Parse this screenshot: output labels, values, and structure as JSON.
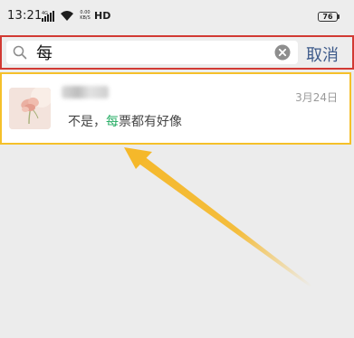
{
  "status_bar": {
    "time": "13:21",
    "network_type": "4G",
    "speed_value": "0.00",
    "speed_unit": "KB/S",
    "hd_label": "HD",
    "battery_level": "76"
  },
  "search": {
    "query": "每",
    "cancel_label": "取消"
  },
  "result": {
    "date": "3月24日",
    "message_prefix": "不是，",
    "message_highlight": "每",
    "message_suffix": "票都有好像"
  },
  "colors": {
    "highlight_green": "#2aae67",
    "search_box_outline": "#d23a33",
    "result_outline": "#f5c02a",
    "arrow": "#f5b82a"
  }
}
